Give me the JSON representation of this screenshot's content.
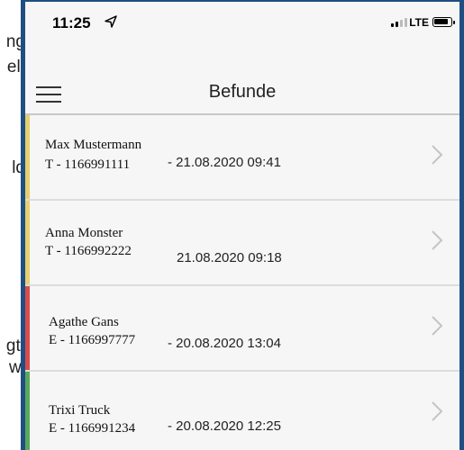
{
  "doc_fragment": {
    "lines": [
      "ng",
      "elt",
      "ld",
      "gt.",
      "w."
    ]
  },
  "status_bar": {
    "time": "11:25",
    "network": "LTE"
  },
  "nav": {
    "title": "Befunde"
  },
  "colors": {
    "frame": "#1f4f82",
    "yellow": "#e6cf6e",
    "red": "#d84c4c",
    "green": "#5aa85a"
  },
  "rows": [
    {
      "name": "Max Mustermann",
      "id": "T - 1166991111",
      "date": "- 21.08.2020 09:41",
      "color": "#e6cf6e"
    },
    {
      "name": "Anna Monster",
      "id": "T - 1166992222",
      "date": "21.08.2020 09:18",
      "color": "#e6cf6e"
    },
    {
      "name": "Agathe Gans",
      "id": "E - 1166997777",
      "date": "- 20.08.2020 13:04",
      "color": "#d84c4c"
    },
    {
      "name": "Trixi Truck",
      "id": "E - 1166991234",
      "date": "- 20.08.2020 12:25",
      "color": "#5aa85a"
    }
  ]
}
